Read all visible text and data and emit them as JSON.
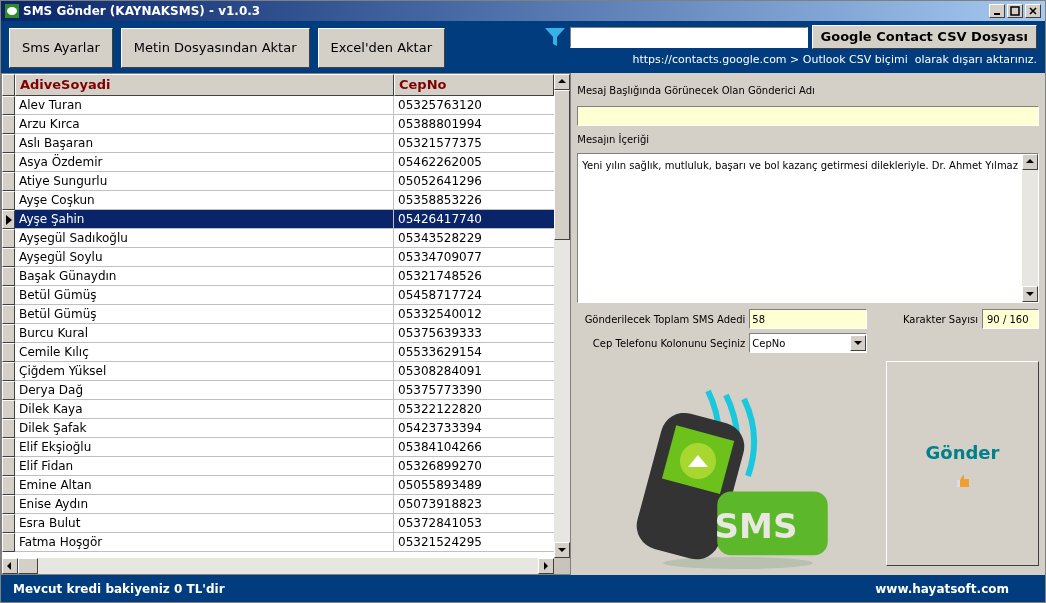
{
  "window": {
    "title": "SMS Gönder (KAYNAKSMS) - v1.0.3"
  },
  "toolbar": {
    "buttons": [
      "Sms Ayarlar",
      "Metin Dosyasından Aktar",
      "Excel'den Aktar"
    ],
    "google_button": "Google Contact CSV Dosyası",
    "hint": "https://contacts.google.com > Outlook CSV biçimi  olarak dışarı aktarınız."
  },
  "table": {
    "columns": [
      "AdiveSoyadi",
      "CepNo"
    ],
    "rows": [
      {
        "name": "Alev Turan",
        "phone": "05325763120",
        "selected": false
      },
      {
        "name": "Arzu Kırca",
        "phone": "05388801994",
        "selected": false
      },
      {
        "name": "Aslı Başaran",
        "phone": "05321577375",
        "selected": false
      },
      {
        "name": "Asya Özdemir",
        "phone": "05462262005",
        "selected": false
      },
      {
        "name": "Atiye Sungurlu",
        "phone": "05052641296",
        "selected": false
      },
      {
        "name": "Ayşe Coşkun",
        "phone": "05358853226",
        "selected": false
      },
      {
        "name": "Ayşe Şahin",
        "phone": "05426417740",
        "selected": true
      },
      {
        "name": "Ayşegül Sadıkoğlu",
        "phone": "05343528229",
        "selected": false
      },
      {
        "name": "Ayşegül Soylu",
        "phone": "05334709077",
        "selected": false
      },
      {
        "name": "Başak Günaydın",
        "phone": "05321748526",
        "selected": false
      },
      {
        "name": "Betül Gümüş",
        "phone": "05458717724",
        "selected": false
      },
      {
        "name": "Betül Gümüş",
        "phone": "05332540012",
        "selected": false
      },
      {
        "name": "Burcu Kural",
        "phone": "05375639333",
        "selected": false
      },
      {
        "name": "Cemile Kılıç",
        "phone": "05533629154",
        "selected": false
      },
      {
        "name": "Çiğdem Yüksel",
        "phone": "05308284091",
        "selected": false
      },
      {
        "name": "Derya Dağ",
        "phone": "05375773390",
        "selected": false
      },
      {
        "name": "Dilek Kaya",
        "phone": "05322122820",
        "selected": false
      },
      {
        "name": "Dilek Şafak",
        "phone": "05423733394",
        "selected": false
      },
      {
        "name": "Elif Ekşioğlu",
        "phone": "05384104266",
        "selected": false
      },
      {
        "name": "Elif Fidan",
        "phone": "05326899270",
        "selected": false
      },
      {
        "name": "Emine Altan",
        "phone": "05055893489",
        "selected": false
      },
      {
        "name": "Enise Aydın",
        "phone": "05073918823",
        "selected": false
      },
      {
        "name": "Esra Bulut",
        "phone": "05372841053",
        "selected": false
      },
      {
        "name": "Fatma Hoşgör",
        "phone": "05321524295",
        "selected": false
      }
    ]
  },
  "form": {
    "sender_label": "Mesaj Başlığında Görünecek Olan Gönderici Adı",
    "message_label": "Mesajın İçeriği",
    "message_value": "Yeni yılın sağlık, mutluluk, başarı ve bol kazanç getirmesi dilekleriyle. Dr. Ahmet Yılmaz",
    "total_label": "Gönderilecek Toplam SMS Adedi",
    "total_value": "58",
    "chars_label": "Karakter Sayısı",
    "chars_value": "90 / 160",
    "column_label": "Cep Telefonu Kolonunu Seçiniz",
    "column_value": "CepNo"
  },
  "illustration": {
    "badge": "SMS"
  },
  "send_button": "Gönder",
  "status_bar": {
    "credit": "Mevcut kredi bakiyeniz 0 TL'dir",
    "website": "www.hayatsoft.com"
  }
}
